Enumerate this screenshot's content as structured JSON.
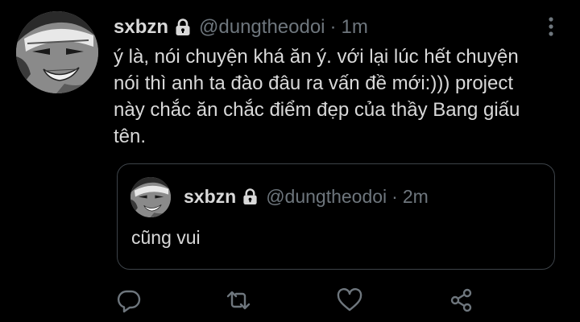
{
  "tweet": {
    "author": {
      "display_name": "sxbzn",
      "handle": "@dungtheodoi",
      "protected_icon": "lock-icon"
    },
    "separator": "·",
    "timestamp": "1m",
    "text": "ý là, nói chuyện khá ăn ý. với lại lúc hết chuyện nói thì anh ta đào đâu ra vấn đề mới:))) project này chắc ăn chắc điểm đẹp của thầy Bang giấu tên.",
    "more_icon": "more-vertical-icon"
  },
  "quoted_tweet": {
    "author": {
      "display_name": "sxbzn",
      "handle": "@dungtheodoi",
      "protected_icon": "lock-icon"
    },
    "separator": "·",
    "timestamp": "2m",
    "text": "cũng vui"
  },
  "actions": [
    {
      "name": "reply",
      "icon": "reply-icon"
    },
    {
      "name": "retweet",
      "icon": "retweet-icon"
    },
    {
      "name": "like",
      "icon": "heart-icon"
    },
    {
      "name": "share",
      "icon": "share-icon"
    }
  ],
  "colors": {
    "background": "#000000",
    "primary_text": "#d9d9d9",
    "secondary_text": "#6e767d",
    "border": "#3d4349",
    "icon": "#6e767d"
  }
}
